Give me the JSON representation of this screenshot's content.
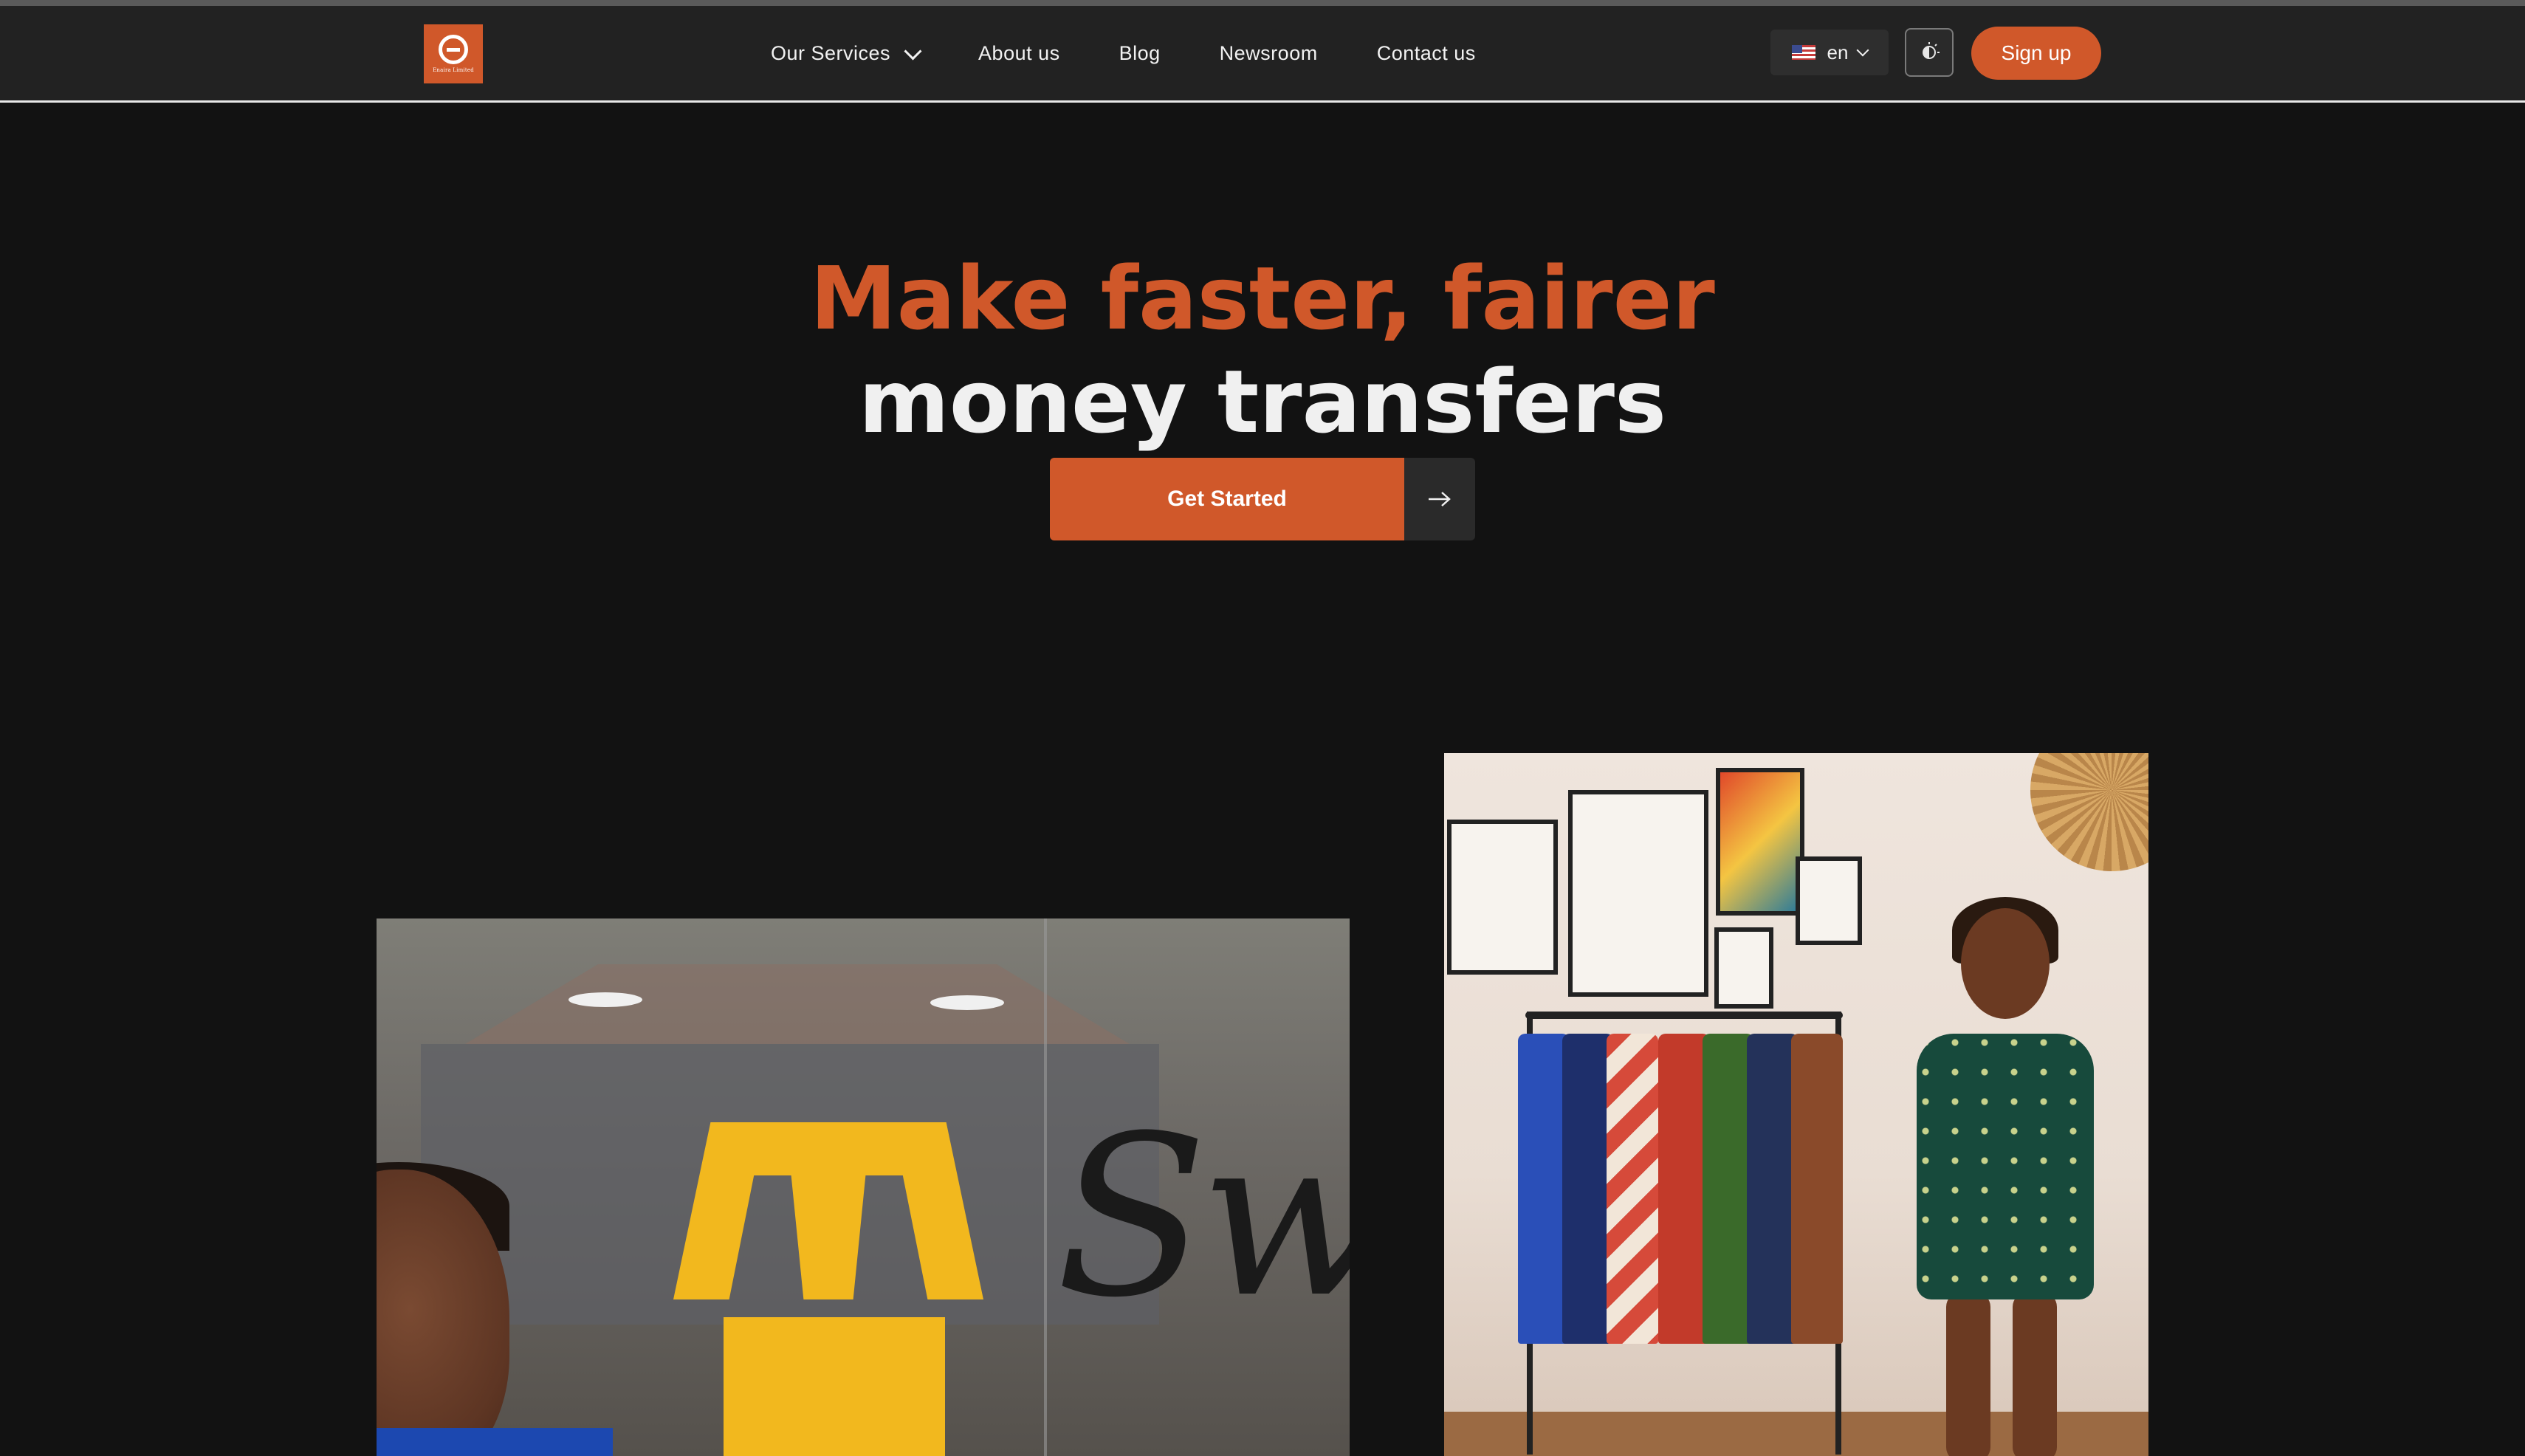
{
  "header": {
    "logo_text": "Enaira Limited",
    "nav": [
      {
        "label": "Our Services",
        "has_dropdown": true
      },
      {
        "label": "About us"
      },
      {
        "label": "Blog"
      },
      {
        "label": "Newsroom"
      },
      {
        "label": "Contact us"
      }
    ],
    "language": {
      "value": "en",
      "flag": "us-flag-icon"
    },
    "theme_toggle_icon": "moon-sun-icon",
    "signup_label": "Sign up"
  },
  "hero": {
    "title_line1": "Make faster, fairer",
    "title_line2": "money transfers",
    "cta_label": "Get Started",
    "cta_icon": "arrow-right-icon"
  },
  "colors": {
    "accent": "#d0582a",
    "background": "#121212",
    "nav_background": "#222222"
  },
  "images": {
    "photo_left_sign_text": "Swee",
    "photo_left_alt": "Smiling shop owner in front of store window",
    "photo_right_alt": "Woman standing next to clothing rack"
  }
}
